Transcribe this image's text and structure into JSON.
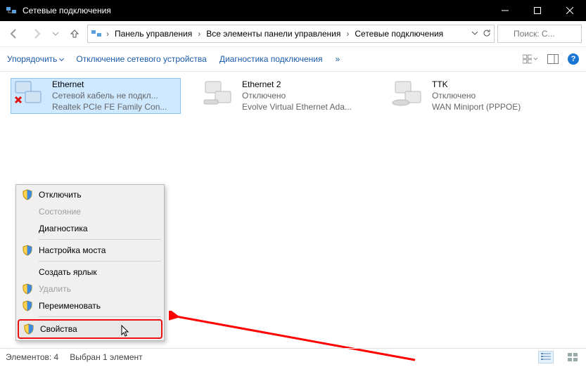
{
  "window": {
    "title": "Сетевые подключения"
  },
  "breadcrumb": {
    "items": [
      "Панель управления",
      "Все элементы панели управления",
      "Сетевые подключения"
    ]
  },
  "search": {
    "placeholder": "Поиск: С..."
  },
  "commands": {
    "organize": "Упорядочить",
    "disable": "Отключение сетевого устройства",
    "diagnose": "Диагностика подключения",
    "more": "»"
  },
  "connections": [
    {
      "name": "Ethernet",
      "status": "Сетевой кабель не подкл...",
      "device": "Realtek PCIe FE Family Con...",
      "selected": true,
      "icon": "nic-unplugged"
    },
    {
      "name": "Ethernet 2",
      "status": "Отключено",
      "device": "Evolve Virtual Ethernet Ada...",
      "selected": false,
      "icon": "nic-disabled"
    },
    {
      "name": "TTK",
      "status": "Отключено",
      "device": "WAN Miniport (PPPOE)",
      "selected": false,
      "icon": "wan-modem"
    }
  ],
  "context_menu": {
    "items": [
      {
        "label": "Отключить",
        "shield": true,
        "disabled": false
      },
      {
        "label": "Состояние",
        "shield": false,
        "disabled": true
      },
      {
        "label": "Диагностика",
        "shield": false,
        "disabled": false
      },
      {
        "sep": true
      },
      {
        "label": "Настройка моста",
        "shield": true,
        "disabled": false
      },
      {
        "sep": true
      },
      {
        "label": "Создать ярлык",
        "shield": false,
        "disabled": false
      },
      {
        "label": "Удалить",
        "shield": true,
        "disabled": true
      },
      {
        "label": "Переименовать",
        "shield": true,
        "disabled": false
      },
      {
        "sep": true
      },
      {
        "label": "Свойства",
        "shield": true,
        "disabled": false,
        "highlighted": true
      }
    ]
  },
  "statusbar": {
    "count": "Элементов: 4",
    "selected": "Выбран 1 элемент"
  },
  "colors": {
    "selection": "#cde8ff",
    "link": "#1a5aa8",
    "annotation": "#ff0000"
  }
}
